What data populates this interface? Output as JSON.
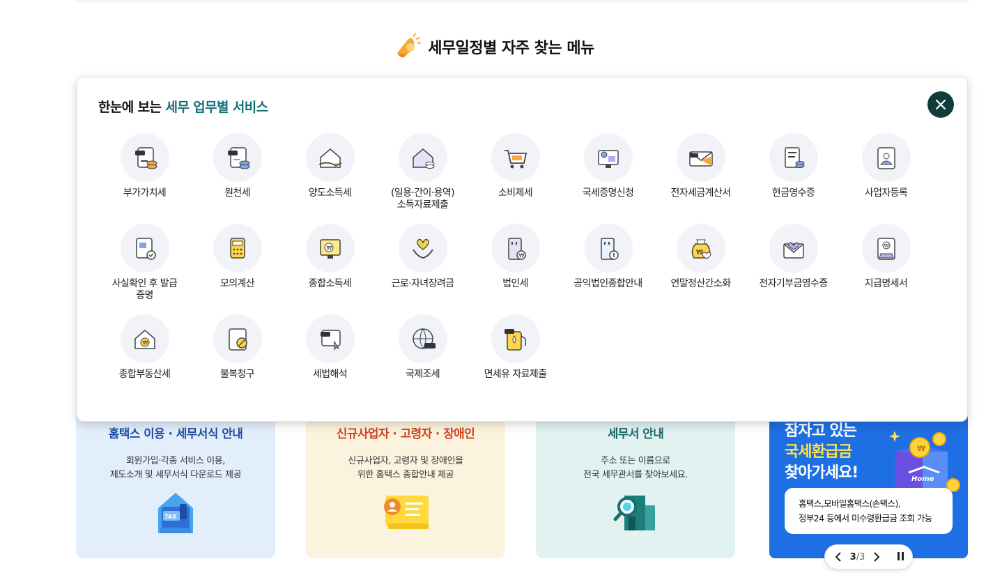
{
  "section": {
    "title": "세무일정별 자주 찾는 메뉴",
    "icon": "bell-icon"
  },
  "panel": {
    "title_prefix": "한눈에 보는 ",
    "title_highlight": "세무 업무별 서비스",
    "close_icon": "close-icon",
    "items": [
      {
        "label": "부가가치세",
        "icon": "vat-document-icon"
      },
      {
        "label": "원천세",
        "icon": "sal-document-icon"
      },
      {
        "label": "양도소득세",
        "icon": "house-hand-icon"
      },
      {
        "label": "(일용·간이·용역)\n소득자료제출",
        "icon": "house-coins-icon"
      },
      {
        "label": "소비제세",
        "icon": "shopping-cart-icon"
      },
      {
        "label": "국세증명신청",
        "icon": "certificate-monitor-icon"
      },
      {
        "label": "전자세금계산서",
        "icon": "tax-envelope-icon"
      },
      {
        "label": "현금영수증",
        "icon": "receipt-coins-icon"
      },
      {
        "label": "사업자등록",
        "icon": "id-card-icon"
      },
      {
        "label": "사실확인 후 발급\n증명",
        "icon": "verified-document-icon"
      },
      {
        "label": "모의계산",
        "icon": "calculator-icon"
      },
      {
        "label": "종합소득세",
        "icon": "won-monitor-icon"
      },
      {
        "label": "근로·자녀장려금",
        "icon": "hands-heart-icon"
      },
      {
        "label": "법인세",
        "icon": "building-won-icon"
      },
      {
        "label": "공익법인종합안내",
        "icon": "building-info-icon"
      },
      {
        "label": "연말정산간소화",
        "icon": "money-bag-icon"
      },
      {
        "label": "전자기부금영수증",
        "icon": "heart-envelope-icon"
      },
      {
        "label": "지급명세서",
        "icon": "won-document-icon"
      },
      {
        "label": "종합부동산세",
        "icon": "house-won-icon"
      },
      {
        "label": "불복청구",
        "icon": "objection-document-icon"
      },
      {
        "label": "세법해석",
        "icon": "tax-law-icon"
      },
      {
        "label": "국제조세",
        "icon": "globe-tax-icon"
      },
      {
        "label": "면세유 자료제출",
        "icon": "fuel-tax-icon"
      }
    ]
  },
  "cards": [
    {
      "title": "홈택스 이용 · 세무서식 안내",
      "desc": "회원가입·각종 서비스 이용,\n제도소개 및 세무서식 다운로드 제공",
      "icon": "tax-folder-icon"
    },
    {
      "title": "신규사업자 · 고령자 · 장애인",
      "desc": "신규사업자, 고령자 및 장애인을\n위한 홈택스 종합안내 제공",
      "icon": "user-card-icon"
    },
    {
      "title": "세무서 안내",
      "desc": "주소 또는 이름으로\n전국 세무관서를 찾아보세요.",
      "icon": "building-search-icon"
    }
  ],
  "banner": {
    "line1": "잠자고 있는",
    "line2": "국세환급금",
    "line3": "찾아가세요!",
    "note_line1": "홈택스,모바일홈택스(손택스),",
    "note_line2": "정부24 등에서 미수령환급금 조회 가능",
    "art_text": "Home",
    "icon": "gift-box-coins-icon"
  },
  "pager": {
    "current": "3",
    "sep_total": "/3",
    "prev_icon": "chevron-left-icon",
    "next_icon": "chevron-right-icon",
    "pause_icon": "pause-icon"
  },
  "colors": {
    "teal": "#127279",
    "close_bg": "#103c3c",
    "banner_bg": "#1d6fe3",
    "highlight_yellow": "#ffe14d",
    "icon_orange": "#f5a742",
    "icon_blue": "#7ea6e8"
  }
}
